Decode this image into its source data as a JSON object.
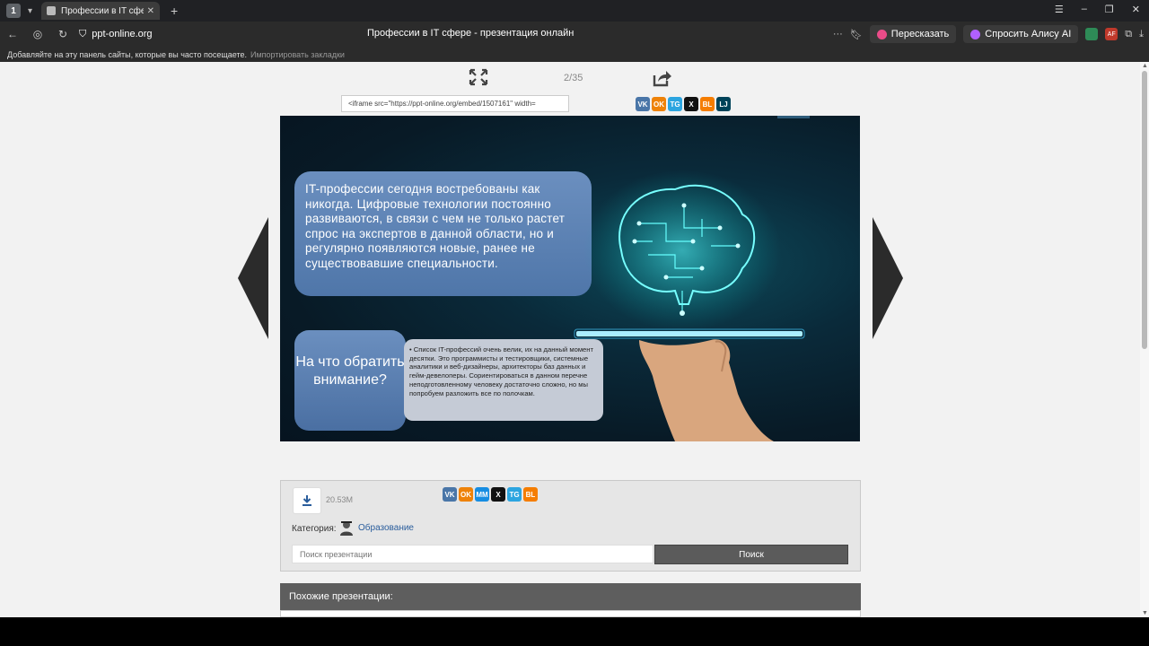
{
  "browser": {
    "tab_count": "1",
    "tab_title": "Профессии в IT сфере",
    "url": "ppt-online.org",
    "page_title": "Профессии в IT сфере - презентация онлайн",
    "retell_button": "Пересказать",
    "ask_alice_button": "Спросить Алису AI",
    "bookmarks_hint": "Добавляйте на эту панель сайты, которые вы часто посещаете.",
    "import_bookmarks": "Импортировать закладки",
    "ext_badge": "AF"
  },
  "viewer": {
    "counter": "2/35",
    "embed_code": "<iframe src=\"https://ppt-online.org/embed/1507161\" width=",
    "share_networks": [
      "VK",
      "OK",
      "TG",
      "X",
      "BL",
      "LJ"
    ]
  },
  "slide": {
    "main_text": "IT-профессии сегодня востребованы как никогда. Цифровые технологии постоянно развиваются, в связи с чем не только растет спрос на экспертов в данной области, но и регулярно появляются новые, ранее не существовавшие специальности.",
    "question_text": "На что обратить внимание?",
    "bullet_text": "Список IT-профессий очень велик, их на данный момент десятки. Это программисты и тестировщики, системные аналитики и веб-дизайнеры, архитекторы баз данных и гейм-девелоперы. Сориентироваться в данном перечне неподготовленному человеку достаточно сложно, но мы попробуем разложить все по полочкам."
  },
  "info": {
    "file_size": "20.53M",
    "category_label": "Категория:",
    "category_value": "Образование",
    "search_placeholder": "Поиск презентации",
    "search_button": "Поиск",
    "share_networks": [
      "VK",
      "OK",
      "MM",
      "X",
      "TG",
      "BL"
    ]
  },
  "similar": {
    "title": "Похожие презентации:"
  },
  "colors": {
    "vk": "#4a76a8",
    "ok": "#ee8208",
    "tg": "#2ca5e0",
    "x": "#111111",
    "blogger": "#f57d00",
    "lj": "#004359",
    "mm": "#168de2",
    "bubble_blue": "#5a7fb3",
    "slide_bg": "#0a2a3a"
  }
}
